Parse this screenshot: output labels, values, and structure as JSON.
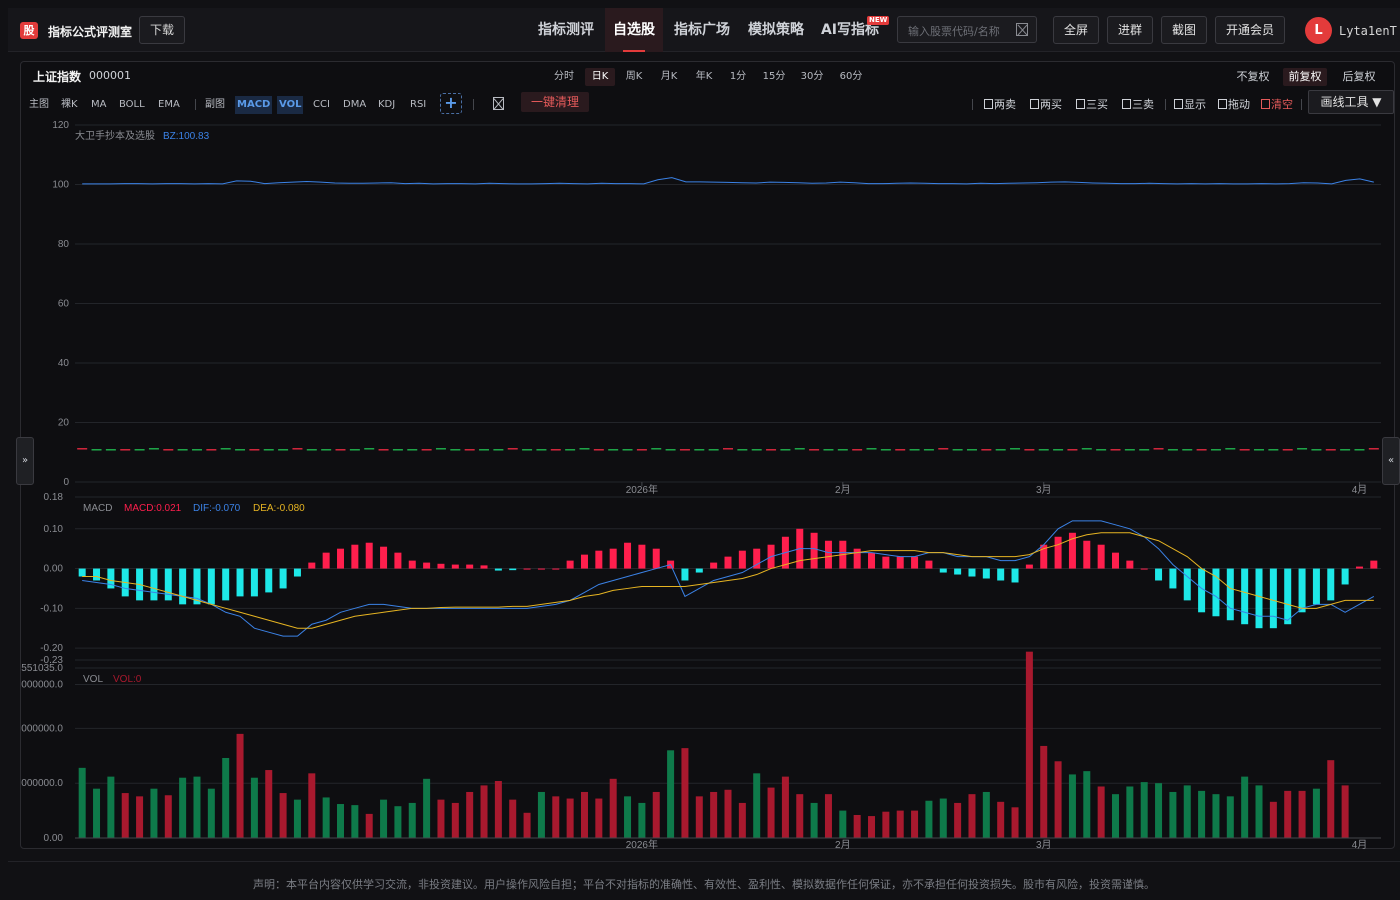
{
  "header": {
    "logo_text": "股",
    "app_title": "指标公式评测室",
    "download_label": "下载",
    "nav": [
      {
        "label": "指标测评",
        "active": false
      },
      {
        "label": "自选股",
        "active": true
      },
      {
        "label": "指标广场",
        "active": false
      },
      {
        "label": "模拟策略",
        "active": false
      },
      {
        "label": "AI写指标",
        "active": false
      }
    ],
    "new_badge": "NEW",
    "search_placeholder": "输入股票代码/名称",
    "buttons": [
      "全屏",
      "进群",
      "截图",
      "开通会员"
    ],
    "avatar_letter": "L",
    "username": "Lyta1enT"
  },
  "stock": {
    "name": "上证指数",
    "code": "000001"
  },
  "periods": [
    {
      "label": "分时",
      "active": false
    },
    {
      "label": "日K",
      "active": true
    },
    {
      "label": "周K",
      "active": false
    },
    {
      "label": "月K",
      "active": false
    },
    {
      "label": "年K",
      "active": false
    },
    {
      "label": "1分",
      "active": false
    },
    {
      "label": "15分",
      "active": false
    },
    {
      "label": "30分",
      "active": false
    },
    {
      "label": "60分",
      "active": false
    }
  ],
  "rights": [
    {
      "label": "不复权",
      "active": false
    },
    {
      "label": "前复权",
      "active": true
    },
    {
      "label": "后复权",
      "active": false
    }
  ],
  "indicator_bar": {
    "main_label": "主图",
    "main_items": [
      "裸K",
      "MA",
      "BOLL",
      "EMA"
    ],
    "sub_label": "副图",
    "sub_items": [
      {
        "label": "MACD",
        "active": true
      },
      {
        "label": "VOL",
        "active": true
      },
      {
        "label": "CCI",
        "active": false
      },
      {
        "label": "DMA",
        "active": false
      },
      {
        "label": "KDJ",
        "active": false
      },
      {
        "label": "RSI",
        "active": false
      }
    ],
    "add_label": "+",
    "reset_label": "一键清理"
  },
  "tools": [
    {
      "label": "两卖",
      "red": false
    },
    {
      "label": "两买",
      "red": false
    },
    {
      "label": "三买",
      "red": false
    },
    {
      "label": "三卖",
      "red": false
    },
    {
      "label": "显示",
      "red": false
    },
    {
      "label": "拖动",
      "red": false
    },
    {
      "label": "清空",
      "red": true
    }
  ],
  "draw_tools_label": "画线工具 ▼",
  "side_tabs": {
    "left": "»",
    "right": "«"
  },
  "footer_text": "声明：本平台内容仅供学习交流，非投资建议。用户操作风险自担；平台不对指标的准确性、有效性、盈利性、模拟数据作任何保证，亦不承担任何投资损失。股市有风险，投资需谨慎。",
  "colors": {
    "accent": "#e33b3b",
    "up": "#ff1f4d",
    "down": "#1ee8e8",
    "vol_up": "#a8192e",
    "vol_down": "#0e7a4a",
    "line_blue": "#3b82e6",
    "line_yellow": "#e6b422"
  },
  "chart_data": [
    {
      "type": "line",
      "name": "main",
      "indicator_label": "大卫手抄本及选股",
      "indicator_value": "BZ:100.83",
      "ylim": [
        0,
        120
      ],
      "yticks": [
        0,
        20,
        40,
        60,
        80,
        100,
        120
      ],
      "xticks": [
        {
          "label": "2026年",
          "index": 39
        },
        {
          "label": "2月",
          "index": 53
        },
        {
          "label": "3月",
          "index": 67
        },
        {
          "label": "4月",
          "index": 89
        }
      ],
      "series": [
        {
          "values": [
            100.2,
            100.2,
            100.2,
            100.3,
            100.3,
            100.2,
            100.3,
            100.3,
            100.2,
            100.3,
            100.2,
            101.2,
            101.1,
            100.3,
            100.6,
            100.8,
            101.0,
            100.8,
            100.5,
            100.4,
            100.4,
            100.5,
            100.6,
            100.3,
            100.4,
            100.2,
            100.3,
            100.3,
            100.2,
            100.4,
            100.3,
            100.2,
            100.2,
            100.3,
            100.4,
            100.3,
            100.2,
            100.4,
            100.3,
            100.3,
            100.2,
            101.6,
            102.3,
            100.9,
            100.9,
            100.8,
            100.7,
            100.6,
            100.5,
            100.8,
            100.7,
            100.6,
            100.4,
            100.5,
            100.8,
            100.6,
            100.3,
            100.3,
            100.4,
            100.5,
            100.4,
            100.3,
            100.3,
            100.2,
            100.4,
            100.3,
            100.4,
            100.5,
            100.6,
            100.8,
            100.9,
            100.7,
            100.5,
            100.4,
            100.3,
            100.3,
            100.4,
            100.3,
            100.2,
            100.3,
            100.2,
            100.3,
            100.2,
            100.2,
            100.3,
            100.2,
            100.3,
            100.6,
            100.5,
            100.2,
            101.4,
            101.9,
            100.8
          ]
        },
        {
          "values": [
            11
          ]
        }
      ]
    },
    {
      "type": "bar",
      "name": "MACD",
      "labels": {
        "macd": "MACD:0.021",
        "dif": "DIF:-0.070",
        "dea": "DEA:-0.080"
      },
      "ylim": [
        -0.23,
        0.18
      ],
      "yticks": [
        0.18,
        0.1,
        0.0,
        -0.1,
        -0.2,
        -0.23
      ],
      "macd": [
        -0.02,
        -0.03,
        -0.05,
        -0.07,
        -0.08,
        -0.08,
        -0.08,
        -0.09,
        -0.09,
        -0.09,
        -0.08,
        -0.07,
        -0.07,
        -0.06,
        -0.05,
        -0.02,
        0.015,
        0.04,
        0.05,
        0.06,
        0.065,
        0.055,
        0.04,
        0.02,
        0.015,
        0.012,
        0.01,
        0.01,
        0.008,
        -0.005,
        -0.004,
        0.0,
        0.0,
        0.0,
        0.02,
        0.035,
        0.045,
        0.05,
        0.065,
        0.06,
        0.05,
        0.02,
        -0.03,
        -0.01,
        0.015,
        0.03,
        0.045,
        0.05,
        0.06,
        0.08,
        0.1,
        0.09,
        0.07,
        0.07,
        0.05,
        0.04,
        0.03,
        0.03,
        0.03,
        0.02,
        -0.01,
        -0.015,
        -0.02,
        -0.025,
        -0.03,
        -0.035,
        0.01,
        0.06,
        0.08,
        0.09,
        0.07,
        0.06,
        0.04,
        0.02,
        0.0,
        -0.03,
        -0.05,
        -0.08,
        -0.11,
        -0.12,
        -0.13,
        -0.14,
        -0.15,
        -0.15,
        -0.14,
        -0.11,
        -0.09,
        -0.08,
        -0.04,
        0.005,
        0.02
      ],
      "dif": [
        -0.03,
        -0.035,
        -0.04,
        -0.05,
        -0.055,
        -0.06,
        -0.065,
        -0.07,
        -0.075,
        -0.09,
        -0.11,
        -0.12,
        -0.15,
        -0.16,
        -0.17,
        -0.17,
        -0.14,
        -0.13,
        -0.11,
        -0.1,
        -0.09,
        -0.09,
        -0.095,
        -0.1,
        -0.1,
        -0.1,
        -0.1,
        -0.1,
        -0.1,
        -0.1,
        -0.1,
        -0.1,
        -0.095,
        -0.09,
        -0.08,
        -0.06,
        -0.04,
        -0.03,
        -0.02,
        -0.01,
        0.0,
        0.01,
        -0.07,
        -0.05,
        -0.03,
        -0.02,
        -0.01,
        0.01,
        0.03,
        0.04,
        0.05,
        0.05,
        0.04,
        0.04,
        0.04,
        0.04,
        0.035,
        0.03,
        0.03,
        0.04,
        0.04,
        0.03,
        0.03,
        0.03,
        0.02,
        0.02,
        0.03,
        0.06,
        0.1,
        0.12,
        0.12,
        0.12,
        0.11,
        0.1,
        0.08,
        0.05,
        0.01,
        -0.02,
        -0.05,
        -0.07,
        -0.1,
        -0.11,
        -0.12,
        -0.12,
        -0.13,
        -0.1,
        -0.09,
        -0.09,
        -0.11,
        -0.09,
        -0.07
      ],
      "dea": [
        -0.02,
        -0.02,
        -0.03,
        -0.035,
        -0.04,
        -0.05,
        -0.06,
        -0.07,
        -0.08,
        -0.09,
        -0.1,
        -0.11,
        -0.12,
        -0.13,
        -0.14,
        -0.15,
        -0.15,
        -0.14,
        -0.13,
        -0.12,
        -0.115,
        -0.11,
        -0.105,
        -0.1,
        -0.1,
        -0.098,
        -0.097,
        -0.097,
        -0.097,
        -0.097,
        -0.095,
        -0.095,
        -0.09,
        -0.085,
        -0.08,
        -0.07,
        -0.065,
        -0.055,
        -0.05,
        -0.045,
        -0.045,
        -0.045,
        -0.045,
        -0.04,
        -0.035,
        -0.03,
        -0.025,
        -0.015,
        0.0,
        0.01,
        0.02,
        0.025,
        0.03,
        0.035,
        0.04,
        0.045,
        0.045,
        0.045,
        0.045,
        0.04,
        0.04,
        0.035,
        0.03,
        0.03,
        0.03,
        0.03,
        0.035,
        0.05,
        0.06,
        0.075,
        0.085,
        0.09,
        0.09,
        0.09,
        0.08,
        0.07,
        0.05,
        0.03,
        0.0,
        -0.02,
        -0.05,
        -0.06,
        -0.07,
        -0.08,
        -0.09,
        -0.1,
        -0.1,
        -0.09,
        -0.08,
        -0.08,
        -0.08
      ]
    },
    {
      "type": "bar",
      "name": "VOL",
      "labels": {
        "vol": "VOL",
        "vol_value": "VOL:0"
      },
      "ylim": [
        0,
        1551035.0
      ],
      "yticks": [
        {
          "label": "551035.0",
          "v": 1551035.0
        },
        {
          "label": "000000.0",
          "v": 1400000
        },
        {
          "label": "000000.0",
          "v": 1000000
        },
        {
          "label": "000000.0",
          "v": 500000
        },
        {
          "label": "0.00",
          "v": 0
        }
      ],
      "xticks": [
        {
          "label": "2026年",
          "index": 39
        },
        {
          "label": "2月",
          "index": 53
        },
        {
          "label": "3月",
          "index": 67
        },
        {
          "label": "4月",
          "index": 89
        }
      ],
      "values": [
        640000,
        450000,
        560000,
        410000,
        380000,
        450000,
        390000,
        550000,
        560000,
        450000,
        730000,
        950000,
        550000,
        620000,
        410000,
        350000,
        590000,
        370000,
        310000,
        300000,
        220000,
        350000,
        290000,
        320000,
        540000,
        350000,
        320000,
        420000,
        480000,
        520000,
        350000,
        230000,
        420000,
        380000,
        360000,
        420000,
        360000,
        540000,
        380000,
        320000,
        420000,
        800000,
        820000,
        380000,
        420000,
        440000,
        320000,
        590000,
        460000,
        560000,
        400000,
        320000,
        400000,
        250000,
        210000,
        200000,
        240000,
        250000,
        250000,
        340000,
        360000,
        320000,
        400000,
        420000,
        330000,
        280000,
        1700000,
        840000,
        700000,
        580000,
        610000,
        470000,
        400000,
        470000,
        510000,
        500000,
        420000,
        480000,
        430000,
        400000,
        380000,
        560000,
        480000,
        330000,
        430000,
        430000,
        450000,
        710000,
        480000
      ],
      "up": [
        0,
        0,
        0,
        1,
        1,
        0,
        1,
        0,
        0,
        0,
        0,
        1,
        0,
        1,
        1,
        0,
        1,
        0,
        0,
        0,
        1,
        0,
        0,
        0,
        0,
        1,
        1,
        1,
        1,
        1,
        1,
        1,
        0,
        1,
        1,
        1,
        1,
        1,
        0,
        0,
        1,
        0,
        1,
        1,
        1,
        1,
        1,
        0,
        1,
        1,
        1,
        0,
        1,
        0,
        1,
        1,
        1,
        1,
        1,
        0,
        0,
        1,
        1,
        0,
        1,
        1,
        1,
        1,
        1,
        0,
        0,
        1,
        0,
        0,
        0,
        0,
        0,
        0,
        0,
        0,
        0,
        0,
        0,
        1,
        1,
        1,
        0,
        1,
        1
      ]
    }
  ]
}
